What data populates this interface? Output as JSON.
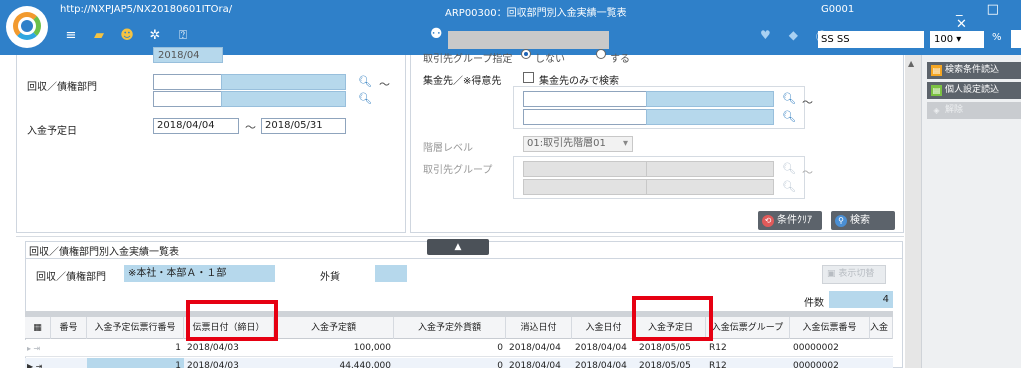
{
  "titlebar": {
    "url": "http://NXPJAP5/NX20180601ITOra/",
    "screen_title": "ARP00300：回収部門別入金実績一覧表",
    "user_code": "G0001",
    "user_name": "SS SS",
    "zoom": "100",
    "zoom_unit": "%",
    "window_controls": "_ □ ✕",
    "icons": [
      "menu-icon",
      "folder-icon",
      "user-icon",
      "settings-icon",
      "help-icon",
      "people-icon",
      "heart-icon",
      "tag-icon",
      "info-icon"
    ]
  },
  "search": {
    "cut_top_value": "2018/04",
    "cut_top_right_label": "取引先グループ指定",
    "radio_off_label": "しない",
    "radio_on_label": "する",
    "dept_label": "回収／債権部門",
    "due_date_label": "入金予定日",
    "due_date_from": "2018/04/04",
    "due_date_to": "2018/05/31",
    "tilde": "～",
    "collect_label": "集金先／※得意先",
    "collect_only_label": "集金先のみで検索",
    "hier_label": "階層レベル",
    "hier_value": "01:取引先階層01",
    "group_label": "取引先グループ",
    "clear_button": "条件ｸﾘｱ",
    "search_button": "検索"
  },
  "side_panel": {
    "load_search_button": "検索条件読込",
    "load_personal_button": "個人設定読込",
    "delete_button": "解除"
  },
  "results": {
    "collapse_label": "▲",
    "title": "回収／債権部門別入金実績一覧表",
    "dept_label": "回収／債権部門",
    "dept_value": "※本社・本部Ａ・１部",
    "fx_label": "外貨",
    "toggle_button": "表示切替",
    "count_label": "件数",
    "count_value": "4"
  },
  "grid": {
    "columns": [
      "番号",
      "入金予定伝票行番号",
      "伝票日付（締日）",
      "入金予定額",
      "入金予定外貨額",
      "消込日付",
      "入金日付",
      "入金予定日",
      "入金伝票グループ",
      "入金伝票番号",
      "入金"
    ],
    "rows": [
      [
        "",
        "1",
        "2018/04/03",
        "100,000",
        "0",
        "2018/04/04",
        "2018/04/04",
        "2018/05/05",
        "R12",
        "00000002",
        ""
      ],
      [
        "",
        "1",
        "2018/04/03",
        "44,440,000",
        "0",
        "2018/04/04",
        "2018/04/04",
        "2018/05/05",
        "R12",
        "00000002",
        ""
      ]
    ]
  }
}
